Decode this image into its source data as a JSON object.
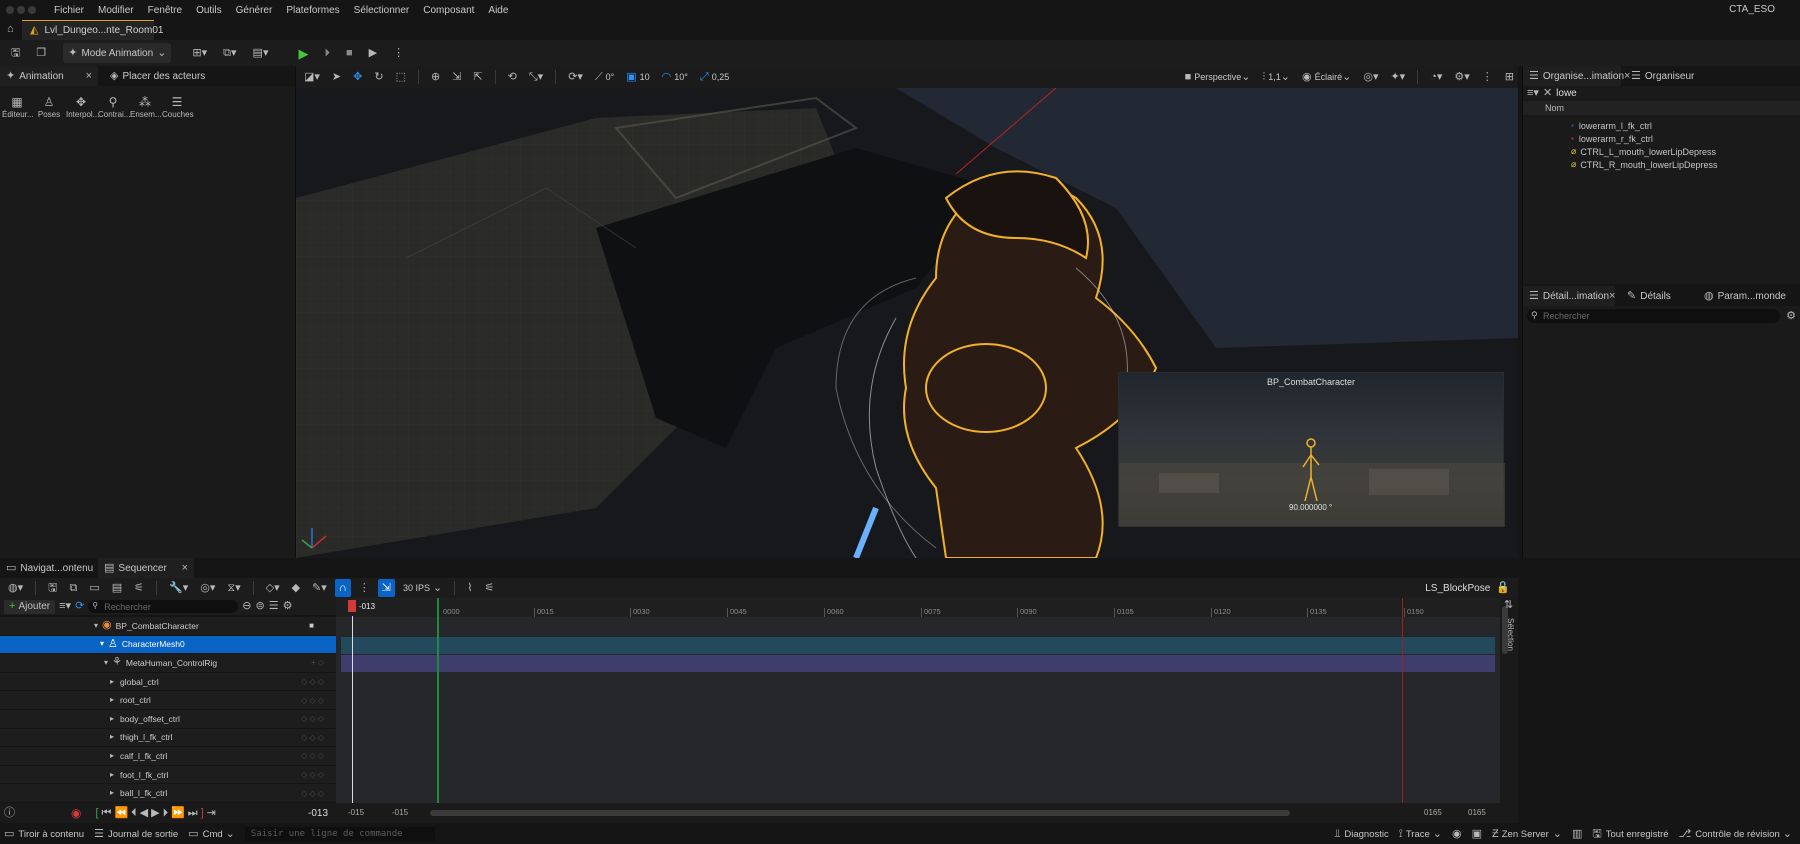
{
  "menubar": {
    "items": [
      "Fichier",
      "Modifier",
      "Fenêtre",
      "Outils",
      "Générer",
      "Plateformes",
      "Sélectionner",
      "Composant",
      "Aide"
    ],
    "project": "CTA_ESO"
  },
  "tabs": {
    "level": "Lvl_Dungeo...nte_Room01"
  },
  "toolbar": {
    "mode": "Mode Animation"
  },
  "left_panel": {
    "tab_animation": "Animation",
    "tab_place": "Placer des acteurs",
    "tools": [
      "Éditeur...",
      "Poses",
      "Interpol...",
      "Contrai...",
      "Ensem...",
      "Couches"
    ]
  },
  "viewport": {
    "angle_value": "0°",
    "snap_grid": "10",
    "snap_rot": "10°",
    "snap_scale": "0,25",
    "perspective": "Perspective",
    "scale": "1,1",
    "lighting": "Éclairé",
    "preview_title": "BP_CombatCharacter",
    "preview_value": "90.000000 °"
  },
  "outliner": {
    "tab1": "Organise...imation",
    "tab2": "Organiseur",
    "filter": "lowe",
    "col_name": "Nom",
    "rows": [
      "lowerarm_l_fk_ctrl",
      "lowerarm_r_fk_ctrl",
      "CTRL_L_mouth_lowerLipDepress",
      "CTRL_R_mouth_lowerLipDepress"
    ]
  },
  "details": {
    "tab1": "Détail...imation",
    "tab2": "Détails",
    "tab3": "Param...monde",
    "search_placeholder": "Rechercher"
  },
  "sequencer": {
    "tab_nav": "Navigat...ontenu",
    "tab_seq": "Sequencer",
    "fps": "30 IPS",
    "sequence_name": "LS_BlockPose",
    "add_label": "Ajouter",
    "search_placeholder": "Rechercher",
    "current_frame": "-013",
    "playhead_frame": "-013",
    "ruler_ticks": [
      "0000",
      "0015",
      "0030",
      "0045",
      "0060",
      "0075",
      "0090",
      "0105",
      "0120",
      "0135",
      "0150"
    ],
    "range_start_a": "-015",
    "range_start_b": "-015",
    "range_end_a": "0165",
    "range_end_b": "0165",
    "side_label": "Sélection",
    "tracks": [
      {
        "label": "BP_CombatCharacter",
        "indent": 0
      },
      {
        "label": "CharacterMesh0",
        "indent": 1
      },
      {
        "label": "MetaHuman_ControlRig",
        "indent": 2
      },
      {
        "label": "global_ctrl",
        "indent": 3
      },
      {
        "label": "root_ctrl",
        "indent": 3
      },
      {
        "label": "body_offset_ctrl",
        "indent": 3
      },
      {
        "label": "thigh_l_fk_ctrl",
        "indent": 3
      },
      {
        "label": "calf_l_fk_ctrl",
        "indent": 3
      },
      {
        "label": "foot_l_fk_ctrl",
        "indent": 3
      },
      {
        "label": "ball_l_fk_ctrl",
        "indent": 3
      }
    ]
  },
  "statusbar": {
    "content_drawer": "Tiroir à contenu",
    "output_log": "Journal de sortie",
    "cmd": "Cmd",
    "cmd_placeholder": "Saisir une ligne de commande",
    "diagnostic": "Diagnostic",
    "trace": "Trace",
    "zen": "Zen Server",
    "saved": "Tout enregistré",
    "revision": "Contrôle de révision"
  }
}
